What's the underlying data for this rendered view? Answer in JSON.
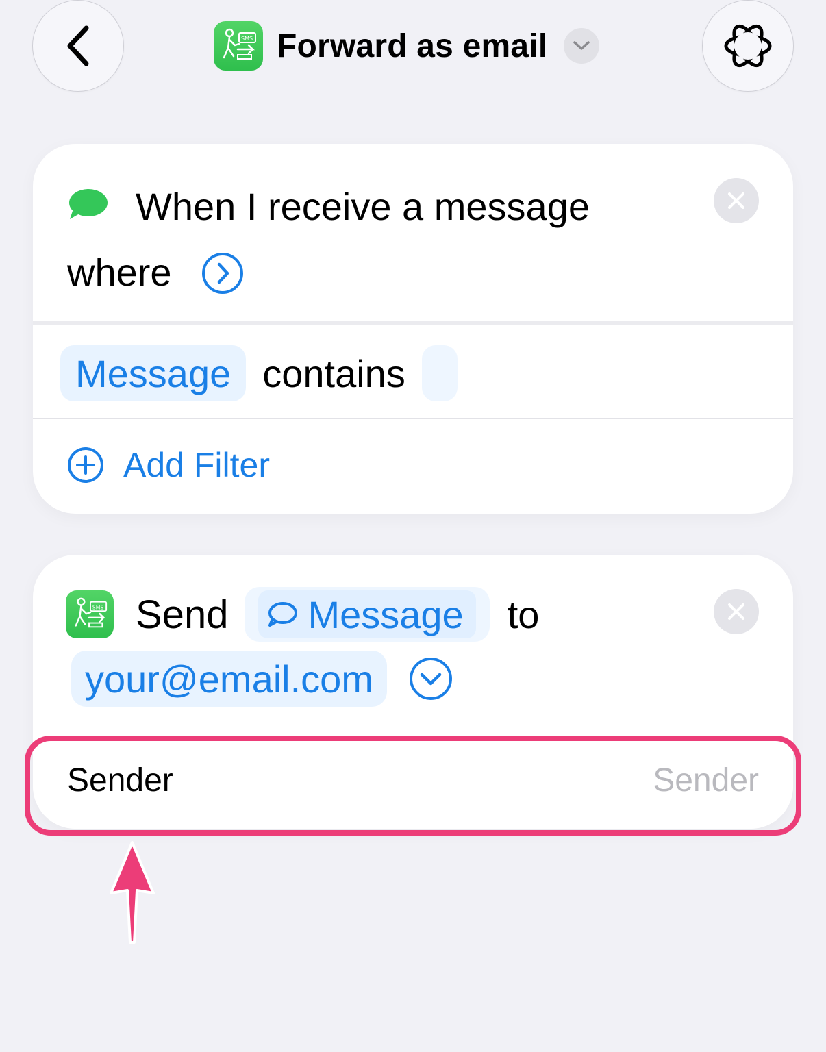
{
  "header": {
    "title": "Forward as email",
    "app_icon_text": "SMS"
  },
  "trigger_card": {
    "title": "When I receive a message",
    "where": "where",
    "filter": {
      "field": "Message",
      "operator": "contains",
      "value": ""
    },
    "add_filter": "Add Filter"
  },
  "action_card": {
    "verb": "Send",
    "message_token": "Message",
    "to": "to",
    "email": "your@email.com",
    "sender_label": "Sender",
    "sender_placeholder": "Sender"
  },
  "colors": {
    "accent": "#1a7fe6",
    "highlight": "#ec3d78",
    "app_green": "#34c759"
  }
}
